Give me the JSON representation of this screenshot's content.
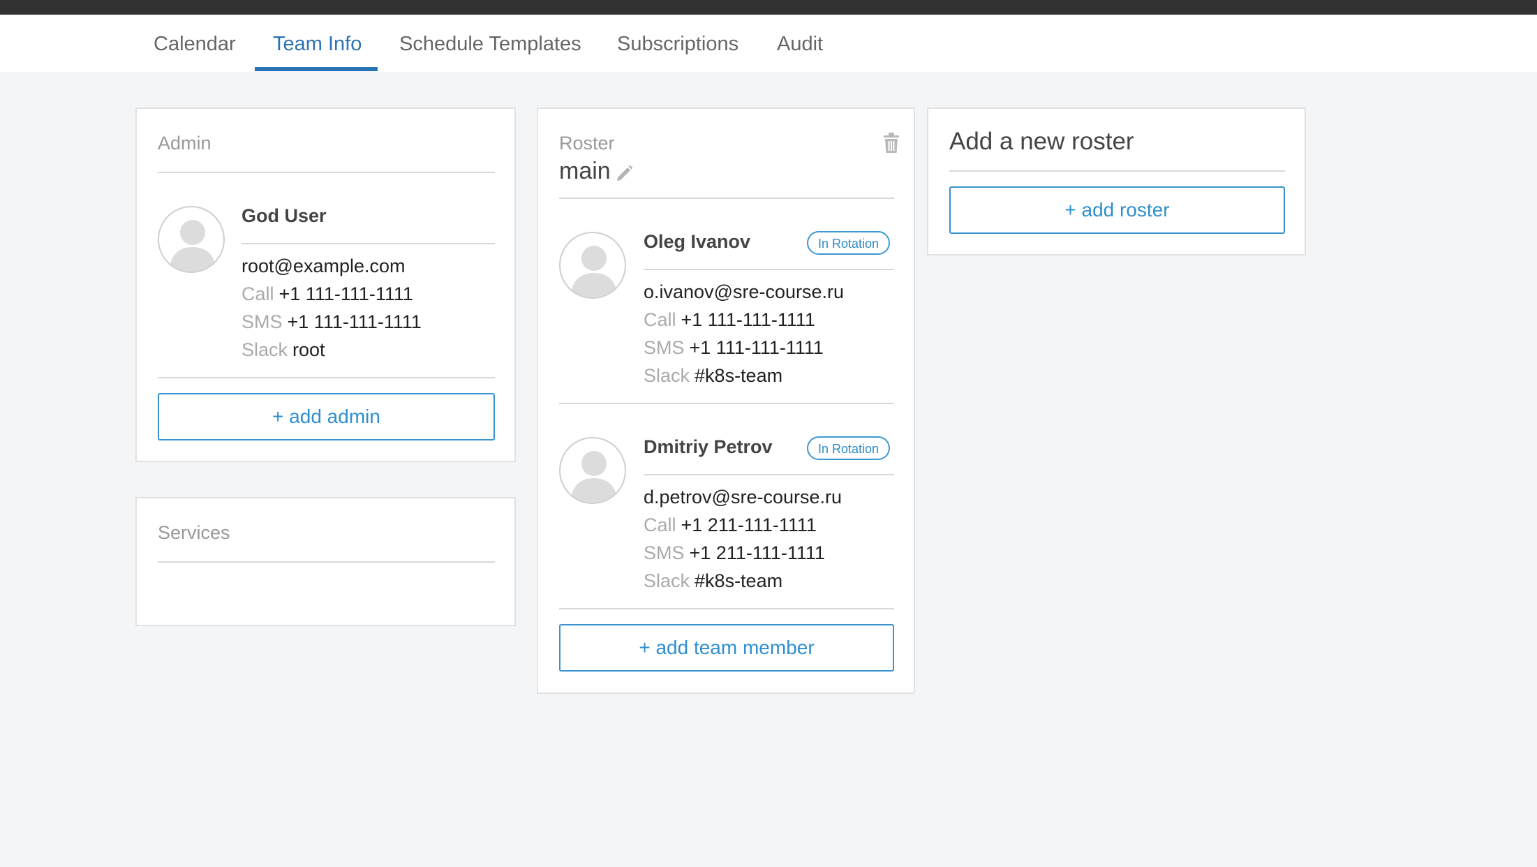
{
  "tabs": [
    {
      "label": "Calendar",
      "active": false
    },
    {
      "label": "Team Info",
      "active": true
    },
    {
      "label": "Schedule Templates",
      "active": false
    },
    {
      "label": "Subscriptions",
      "active": false
    },
    {
      "label": "Audit",
      "active": false
    }
  ],
  "admin": {
    "title": "Admin",
    "user": {
      "name": "God User",
      "email": "root@example.com",
      "call_label": "Call",
      "call": "+1 111-111-1111",
      "sms_label": "SMS",
      "sms": "+1 111-111-1111",
      "slack_label": "Slack",
      "slack": "root"
    },
    "add_label": "+ add admin"
  },
  "services": {
    "title": "Services"
  },
  "roster": {
    "title": "Roster",
    "name": "main",
    "members": [
      {
        "name": "Oleg Ivanov",
        "badge": "In Rotation",
        "email": "o.ivanov@sre-course.ru",
        "call_label": "Call",
        "call": "+1 111-111-1111",
        "sms_label": "SMS",
        "sms": "+1 111-111-1111",
        "slack_label": "Slack",
        "slack": "#k8s-team"
      },
      {
        "name": "Dmitriy Petrov",
        "badge": "In Rotation",
        "email": "d.petrov@sre-course.ru",
        "call_label": "Call",
        "call": "+1 211-111-1111",
        "sms_label": "SMS",
        "sms": "+1 211-111-1111",
        "slack_label": "Slack",
        "slack": "#k8s-team"
      }
    ],
    "add_label": "+ add team member"
  },
  "new_roster": {
    "title": "Add a new roster",
    "add_label": "+ add roster"
  },
  "colors": {
    "accent": "#2a73b5",
    "button_blue": "#2f8fce",
    "background": "#f4f5f7",
    "topbar": "#323232"
  },
  "icons": {
    "avatar": "user-silhouette-icon",
    "edit": "pencil-icon",
    "delete": "trash-icon"
  }
}
